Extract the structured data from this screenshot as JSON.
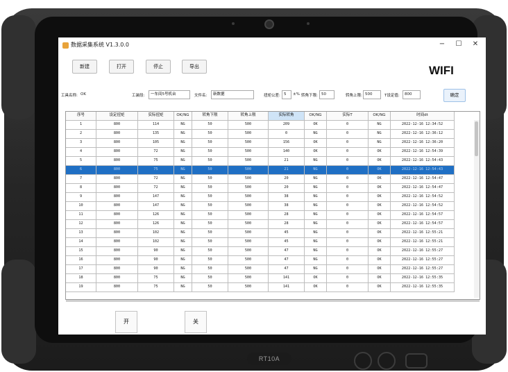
{
  "window": {
    "title": "数据采集系统 V1.3.0.0",
    "minimize": "−",
    "maximize": "☐",
    "close": "✕"
  },
  "toolbar": {
    "new": "新建",
    "open": "打开",
    "stop": "停止",
    "export": "导出"
  },
  "status": {
    "wifi": "WIFI"
  },
  "params": {
    "tool_name_label": "工具名称:",
    "tool_name_value": "OK",
    "station_label": "工装段:",
    "station_value": "一车间5号机台",
    "file_label": "文件名:",
    "file_value": "新数据",
    "torque_tol_label": "扭矩公差:",
    "torque_tol_value": "5",
    "torque_tol_unit": "±%",
    "angle_low_label": "转角下限:",
    "angle_low_value": "50",
    "angle_high_label": "转角上限:",
    "angle_high_value": "500",
    "t_set_label": "T设定值:",
    "t_set_value": "800",
    "confirm": "确定"
  },
  "table": {
    "columns": [
      "序号",
      "设定扭矩",
      "实际扭矩",
      "OK/NG",
      "转角下限",
      "转角上限",
      "实际转角",
      "OK/NG",
      "实际T",
      "OK/NG",
      "时间dt"
    ],
    "rows": [
      [
        "1",
        "800",
        "114",
        "NG",
        "50",
        "500",
        "209",
        "OK",
        "0",
        "NG",
        "2022-12-16 12:34:52"
      ],
      [
        "2",
        "800",
        "135",
        "NG",
        "50",
        "500",
        "0",
        "NG",
        "0",
        "NG",
        "2022-12-16 12:36:12"
      ],
      [
        "3",
        "800",
        "105",
        "NG",
        "50",
        "500",
        "156",
        "OK",
        "0",
        "NG",
        "2022-12-16 12:36:20"
      ],
      [
        "4",
        "800",
        "72",
        "NG",
        "50",
        "500",
        "140",
        "OK",
        "0",
        "OK",
        "2022-12-16 12:54:39"
      ],
      [
        "5",
        "800",
        "75",
        "NG",
        "50",
        "500",
        "21",
        "NG",
        "0",
        "OK",
        "2022-12-16 12:54:43"
      ],
      [
        "6",
        "800",
        "75",
        "NG",
        "50",
        "500",
        "21",
        "NG",
        "0",
        "OK",
        "2022-12-16 12:54:43"
      ],
      [
        "7",
        "800",
        "72",
        "NG",
        "50",
        "500",
        "20",
        "NG",
        "0",
        "OK",
        "2022-12-16 12:54:47"
      ],
      [
        "8",
        "800",
        "72",
        "NG",
        "50",
        "500",
        "20",
        "NG",
        "0",
        "OK",
        "2022-12-16 12:54:47"
      ],
      [
        "9",
        "800",
        "147",
        "NG",
        "50",
        "500",
        "38",
        "NG",
        "0",
        "OK",
        "2022-12-16 12:54:52"
      ],
      [
        "10",
        "800",
        "147",
        "NG",
        "50",
        "500",
        "38",
        "NG",
        "0",
        "OK",
        "2022-12-16 12:54:52"
      ],
      [
        "11",
        "800",
        "126",
        "NG",
        "50",
        "500",
        "28",
        "NG",
        "0",
        "OK",
        "2022-12-16 12:54:57"
      ],
      [
        "12",
        "800",
        "126",
        "NG",
        "50",
        "500",
        "28",
        "NG",
        "0",
        "OK",
        "2022-12-16 12:54:57"
      ],
      [
        "13",
        "800",
        "102",
        "NG",
        "50",
        "500",
        "45",
        "NG",
        "0",
        "OK",
        "2022-12-16 12:55:21"
      ],
      [
        "14",
        "800",
        "102",
        "NG",
        "50",
        "500",
        "45",
        "NG",
        "0",
        "OK",
        "2022-12-16 12:55:21"
      ],
      [
        "15",
        "800",
        "90",
        "NG",
        "50",
        "500",
        "47",
        "NG",
        "0",
        "OK",
        "2022-12-16 12:55:27"
      ],
      [
        "16",
        "800",
        "90",
        "NG",
        "50",
        "500",
        "47",
        "NG",
        "0",
        "OK",
        "2022-12-16 12:55:27"
      ],
      [
        "17",
        "800",
        "90",
        "NG",
        "50",
        "500",
        "47",
        "NG",
        "0",
        "OK",
        "2022-12-16 12:55:27"
      ],
      [
        "18",
        "800",
        "75",
        "NG",
        "50",
        "500",
        "141",
        "OK",
        "0",
        "OK",
        "2022-12-16 12:55:35"
      ],
      [
        "19",
        "800",
        "75",
        "NG",
        "50",
        "500",
        "141",
        "OK",
        "0",
        "OK",
        "2022-12-16 12:55:35"
      ]
    ],
    "selected_row": 6
  },
  "actions": {
    "on": "开",
    "off": "关"
  },
  "device": {
    "model": "RT10A"
  },
  "colors": {
    "selection": "#1f6fc4",
    "header_highlight": "#cfe4f7",
    "app_icon": "#e8a33a"
  },
  "icons": {
    "app": "app-logo-icon",
    "camera": "camera-icon"
  }
}
